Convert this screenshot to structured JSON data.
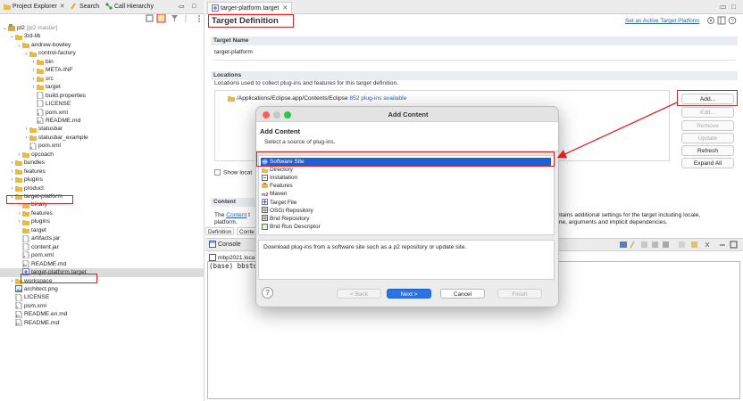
{
  "left_tabs": {
    "project_explorer": "Project Explorer",
    "search": "Search",
    "call_hierarchy": "Call Hierarchy"
  },
  "tree": [
    {
      "label": "pl2",
      "suffix": "[pl2 master]",
      "depth": 0,
      "arrow": "down",
      "icon": "project-icon"
    },
    {
      "label": "3rd-lib",
      "depth": 1,
      "arrow": "down",
      "icon": "folder-icon"
    },
    {
      "label": "andrew-bowley",
      "depth": 2,
      "arrow": "down",
      "icon": "folder-icon"
    },
    {
      "label": "control-factory",
      "depth": 3,
      "arrow": "down",
      "icon": "folder-icon"
    },
    {
      "label": "bin",
      "depth": 4,
      "arrow": "right",
      "icon": "folder-icon"
    },
    {
      "label": "META-INF",
      "depth": 4,
      "arrow": "right",
      "icon": "folder-icon"
    },
    {
      "label": "src",
      "depth": 4,
      "arrow": "right",
      "icon": "folder-icon"
    },
    {
      "label": "target",
      "depth": 4,
      "arrow": "right",
      "icon": "folder-icon"
    },
    {
      "label": "build.properties",
      "depth": 4,
      "arrow": "none",
      "icon": "file-icon"
    },
    {
      "label": "LICENSE",
      "depth": 4,
      "arrow": "none",
      "icon": "file-icon"
    },
    {
      "label": "pom.xml",
      "depth": 4,
      "arrow": "none",
      "icon": "xml-file-icon"
    },
    {
      "label": "README.md",
      "depth": 4,
      "arrow": "none",
      "icon": "markdown-file-icon"
    },
    {
      "label": "statusbar",
      "depth": 3,
      "arrow": "right",
      "icon": "folder-icon"
    },
    {
      "label": "statusbar_example",
      "depth": 3,
      "arrow": "right",
      "icon": "folder-icon"
    },
    {
      "label": "pom.xml",
      "depth": 3,
      "arrow": "none",
      "icon": "xml-file-icon"
    },
    {
      "label": "opcoach",
      "depth": 2,
      "arrow": "right",
      "icon": "folder-icon"
    },
    {
      "label": "bundles",
      "depth": 1,
      "arrow": "right",
      "icon": "folder-icon"
    },
    {
      "label": "features",
      "depth": 1,
      "arrow": "right",
      "icon": "folder-icon"
    },
    {
      "label": "plugins",
      "depth": 1,
      "arrow": "right",
      "icon": "folder-icon"
    },
    {
      "label": "product",
      "depth": 1,
      "arrow": "right",
      "icon": "folder-icon"
    },
    {
      "label": "target-platform",
      "depth": 1,
      "arrow": "down",
      "icon": "folder-icon"
    },
    {
      "label": "binary",
      "depth": 2,
      "arrow": "right",
      "icon": "folder-icon"
    },
    {
      "label": "features",
      "depth": 2,
      "arrow": "right",
      "icon": "folder-icon"
    },
    {
      "label": "plugins",
      "depth": 2,
      "arrow": "right",
      "icon": "folder-icon"
    },
    {
      "label": "target",
      "depth": 2,
      "arrow": "none",
      "icon": "folder-icon"
    },
    {
      "label": "artifacts.jar",
      "depth": 2,
      "arrow": "none",
      "icon": "file-icon"
    },
    {
      "label": "content.jar",
      "depth": 2,
      "arrow": "none",
      "icon": "file-icon"
    },
    {
      "label": "pom.xml",
      "depth": 2,
      "arrow": "none",
      "icon": "xml-file-icon"
    },
    {
      "label": "README.md",
      "depth": 2,
      "arrow": "none",
      "icon": "markdown-file-icon"
    },
    {
      "label": "target-platform.target",
      "depth": 2,
      "arrow": "none",
      "icon": "target-file-icon",
      "selected": true
    },
    {
      "label": "workspace",
      "depth": 1,
      "arrow": "right",
      "icon": "folder-icon"
    },
    {
      "label": "architect.png",
      "depth": 1,
      "arrow": "none",
      "icon": "image-file-icon"
    },
    {
      "label": "LICENSE",
      "depth": 1,
      "arrow": "none",
      "icon": "file-icon"
    },
    {
      "label": "pom.xml",
      "depth": 1,
      "arrow": "none",
      "icon": "xml-file-icon"
    },
    {
      "label": "README.en.md",
      "depth": 1,
      "arrow": "none",
      "icon": "markdown-file-icon"
    },
    {
      "label": "README.md",
      "depth": 1,
      "arrow": "none",
      "icon": "markdown-file-icon"
    }
  ],
  "editor": {
    "tab_label": "target-platform.target",
    "title": "Target Definition",
    "set_active_link": "Set as Active Target Platform",
    "target_name_header": "Target Name",
    "target_name_value": "target-platform",
    "locations_header": "Locations",
    "locations_desc": "Locations used to collect plug-ins and features for this target definition.",
    "location_path": "/Applications/Eclipse.app/Contents/Eclipse",
    "location_count": "852 plug-ins available",
    "buttons": {
      "add": "Add...",
      "edit": "Edit...",
      "remove": "Remove",
      "update": "Update",
      "refresh": "Refresh",
      "expand_all": "Expand All"
    },
    "show_locations": "Show locat",
    "content_header": "Content",
    "content_text_pre": "The",
    "content_link": "Content",
    "content_text_post": "t",
    "content_text_line2": "platform.",
    "content_right_line1": "contains additional settings for the target including locale,",
    "content_right_line2": "ntime, arguments and implicit dependencies.",
    "bottom_tabs": [
      "Definition",
      "Conte"
    ]
  },
  "console": {
    "tab_label": "Console",
    "line1": "mbp2021.loca",
    "line2": "(base) bbsto"
  },
  "dialog": {
    "window_title": "Add Content",
    "heading": "Add Content",
    "subheading": "Select a source of plug-ins.",
    "items": [
      {
        "label": "Software Site",
        "icon": "software-site-icon",
        "selected": true
      },
      {
        "label": "Directory",
        "icon": "folder-icon"
      },
      {
        "label": "Installation",
        "icon": "installation-icon"
      },
      {
        "label": "Features",
        "icon": "features-icon"
      },
      {
        "label": "Maven",
        "icon": "maven-icon"
      },
      {
        "label": "Target File",
        "icon": "target-file-icon"
      },
      {
        "label": "OSGi Repository",
        "icon": "repository-icon"
      },
      {
        "label": "Bnd Repository",
        "icon": "repository-icon"
      },
      {
        "label": "Bnd Run Descriptor",
        "icon": "descriptor-icon"
      }
    ],
    "description": "Download plug-ins from a software site such as a p2 repository or update site.",
    "buttons": {
      "help": "?",
      "back": "< Back",
      "next": "Next >",
      "cancel": "Cancel",
      "finish": "Finish"
    }
  },
  "colors": {
    "highlight_red": "#e02020",
    "selection_blue": "#1f5fd4",
    "link_blue": "#2a5db0",
    "primary_button": "#2b72e6"
  }
}
